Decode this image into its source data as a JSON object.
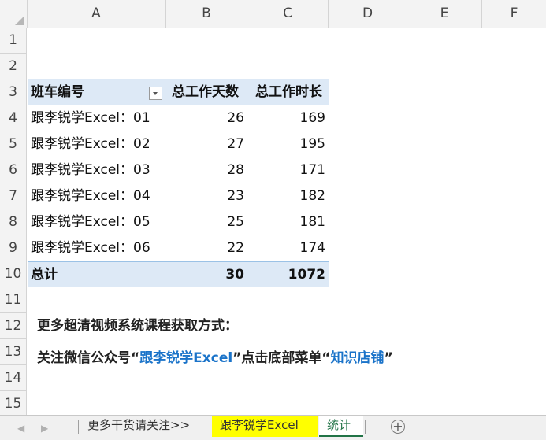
{
  "columns": [
    "A",
    "B",
    "C",
    "D",
    "E",
    "F"
  ],
  "rows": [
    "1",
    "2",
    "3",
    "4",
    "5",
    "6",
    "7",
    "8",
    "9",
    "10",
    "11",
    "12",
    "13",
    "14",
    "15"
  ],
  "pivot": {
    "header": {
      "label": "班车编号",
      "days": "总工作天数",
      "hours": "总工作时长"
    },
    "records": [
      {
        "label": "跟李锐学Excel：01",
        "days": "26",
        "hours": "169"
      },
      {
        "label": "跟李锐学Excel：02",
        "days": "27",
        "hours": "195"
      },
      {
        "label": "跟李锐学Excel：03",
        "days": "28",
        "hours": "171"
      },
      {
        "label": "跟李锐学Excel：04",
        "days": "23",
        "hours": "182"
      },
      {
        "label": "跟李锐学Excel：05",
        "days": "25",
        "hours": "181"
      },
      {
        "label": "跟李锐学Excel：06",
        "days": "22",
        "hours": "174"
      }
    ],
    "total": {
      "label": "总计",
      "days": "30",
      "hours": "1072"
    }
  },
  "notes": {
    "line1": "更多超清视频系统课程获取方式：",
    "line2_prefix": "关注微信公众号“",
    "line2_account": "跟李锐学Excel",
    "line2_middle": "”点击底部菜单“",
    "line2_menu": "知识店铺",
    "line2_suffix": "”"
  },
  "tabs": {
    "tab1": "更多干货请关注>>",
    "tab2": "跟李锐学Excel",
    "tab3": "统计",
    "add": "+"
  },
  "icons": {
    "prev": "◀",
    "next": "▶"
  }
}
